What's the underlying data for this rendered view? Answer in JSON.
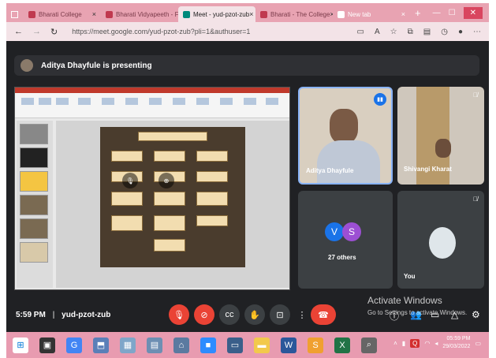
{
  "browser": {
    "tabs": [
      {
        "label": "Bharati College"
      },
      {
        "label": "Bharati Vidyapeeth - FMS"
      },
      {
        "label": "Meet - yud-pzot-zub",
        "active": true
      },
      {
        "label": "Bharati - The College"
      },
      {
        "label": "New tab"
      }
    ],
    "url": "https://meet.google.com/yud-pzot-zub?pli=1&authuser=1"
  },
  "meet": {
    "presenting_banner": "Aditya Dhayfule is presenting",
    "participants": [
      {
        "name": "Aditya Dhayfule",
        "speaking": true
      },
      {
        "name": "Shivangi Kharat",
        "muted": true
      },
      {
        "others_label": "27 others",
        "avatars": [
          "V",
          "S"
        ]
      },
      {
        "name": "You",
        "muted": true
      }
    ],
    "time": "5:59 PM",
    "separator": "|",
    "meeting_code": "yud-pzot-zub",
    "colors": {
      "bg": "#202124",
      "tile": "#3c4043",
      "accent": "#1a73e8",
      "danger": "#ea4335"
    }
  },
  "watermark": {
    "title": "Activate Windows",
    "subtitle": "Go to Settings to activate Windows."
  },
  "taskbar": {
    "time": "05:59 PM",
    "date": "29/03/2022"
  }
}
